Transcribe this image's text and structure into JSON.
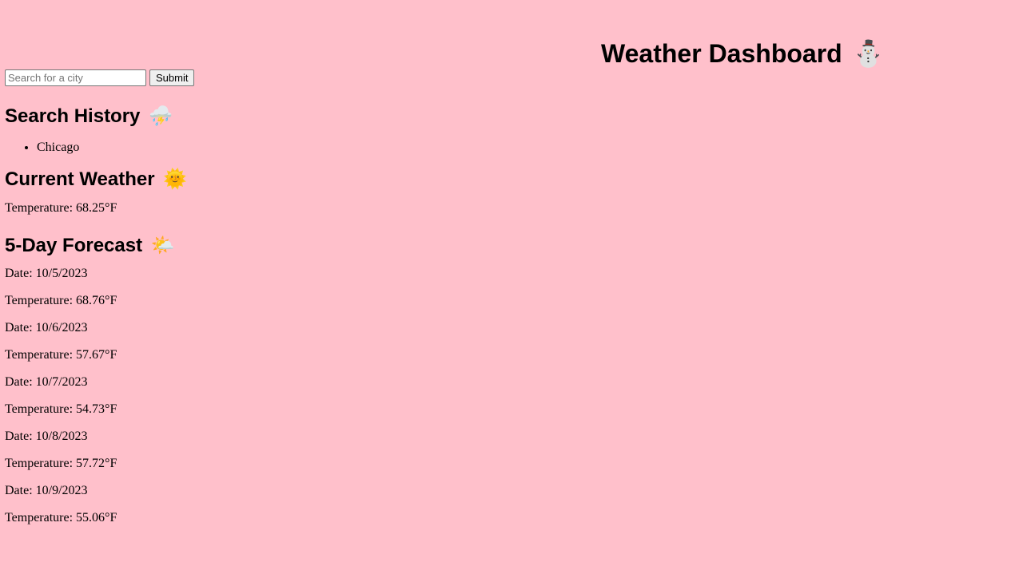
{
  "header": {
    "title": "Weather Dashboard",
    "title_emoji": "⛄"
  },
  "search": {
    "placeholder": "Search for a city",
    "value": "",
    "submit_label": "Submit"
  },
  "history": {
    "heading": "Search History",
    "emoji": "⛈️",
    "items": [
      "Chicago"
    ]
  },
  "current": {
    "heading": "Current Weather",
    "emoji": "🌞",
    "temperature_line": "Temperature: 68.25°F"
  },
  "forecast": {
    "heading": "5-Day Forecast",
    "emoji": "🌤️",
    "days": [
      {
        "date_line": "Date: 10/5/2023",
        "temp_line": "Temperature: 68.76°F"
      },
      {
        "date_line": "Date: 10/6/2023",
        "temp_line": "Temperature: 57.67°F"
      },
      {
        "date_line": "Date: 10/7/2023",
        "temp_line": "Temperature: 54.73°F"
      },
      {
        "date_line": "Date: 10/8/2023",
        "temp_line": "Temperature: 57.72°F"
      },
      {
        "date_line": "Date: 10/9/2023",
        "temp_line": "Temperature: 55.06°F"
      }
    ]
  },
  "colors": {
    "background": "#ffc0cb"
  }
}
